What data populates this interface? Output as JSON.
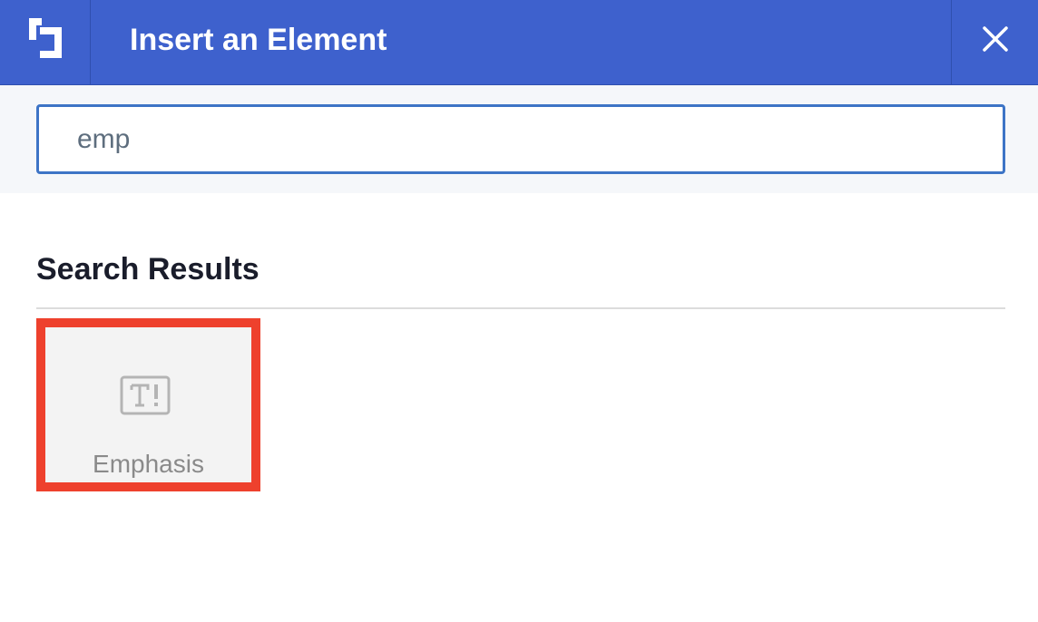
{
  "header": {
    "title": "Insert an Element",
    "logo_icon": "layout-brand-logo-icon",
    "close_icon": "close-icon",
    "background_color": "#3e61cd"
  },
  "search": {
    "value": "emp",
    "border_color": "#3d74c6"
  },
  "results": {
    "heading": "Search Results",
    "items": [
      {
        "label": "Emphasis",
        "icon": "text-emphasis-icon",
        "icon_glyph": "T!",
        "highlight_color": "#ee412d"
      }
    ]
  }
}
